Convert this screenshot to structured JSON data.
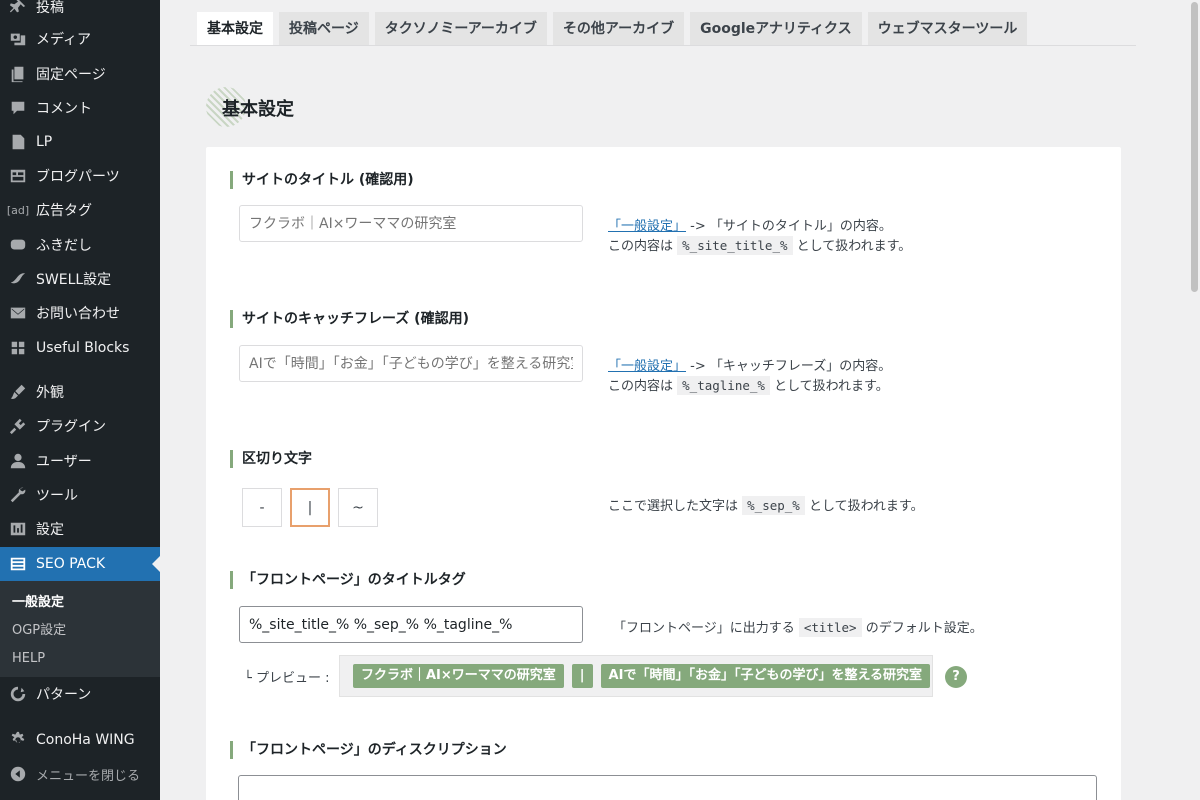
{
  "sidebar": {
    "items": [
      {
        "label": "投稿",
        "icon": "pin-icon"
      },
      {
        "label": "メディア",
        "icon": "media-icon"
      },
      {
        "label": "固定ページ",
        "icon": "page-icon"
      },
      {
        "label": "コメント",
        "icon": "comment-icon"
      },
      {
        "label": "LP",
        "icon": "document-icon"
      },
      {
        "label": "ブログパーツ",
        "icon": "blocks-icon"
      },
      {
        "label": "広告タグ",
        "icon": "ad-icon",
        "icon_text": "[ad]"
      },
      {
        "label": "ふきだし",
        "icon": "speech-bubble-icon"
      },
      {
        "label": "SWELL設定",
        "icon": "swell-icon"
      },
      {
        "label": "お問い合わせ",
        "icon": "mail-icon"
      },
      {
        "label": "Useful Blocks",
        "icon": "grid-icon"
      },
      {
        "label": "外観",
        "icon": "brush-icon"
      },
      {
        "label": "プラグイン",
        "icon": "plugin-icon"
      },
      {
        "label": "ユーザー",
        "icon": "user-icon"
      },
      {
        "label": "ツール",
        "icon": "wrench-icon"
      },
      {
        "label": "設定",
        "icon": "settings-icon"
      },
      {
        "label": "SEO PACK",
        "icon": "list-icon",
        "active": true
      }
    ],
    "submenu": [
      {
        "label": "一般設定",
        "current": true
      },
      {
        "label": "OGP設定"
      },
      {
        "label": "HELP"
      }
    ],
    "after": [
      {
        "label": "パターン",
        "icon": "pattern-icon"
      },
      {
        "label": "ConoHa WING",
        "icon": "gear-icon"
      },
      {
        "label": "メニューを閉じる",
        "icon": "collapse-icon"
      }
    ]
  },
  "tabs": [
    {
      "label": "基本設定",
      "active": true
    },
    {
      "label": "投稿ページ"
    },
    {
      "label": "タクソノミーアーカイブ"
    },
    {
      "label": "その他アーカイブ"
    },
    {
      "label": "Googleアナリティクス"
    },
    {
      "label": "ウェブマスターツール"
    }
  ],
  "section_title": "基本設定",
  "fields": {
    "site_title": {
      "label": "サイトのタイトル (確認用)",
      "placeholder": "フクラボ｜AI×ワーママの研究室",
      "desc_link": "「一般設定」",
      "desc_line1": " -> 「サイトのタイトル」の内容。",
      "desc_line2_pre": "この内容は ",
      "desc_code": "%_site_title_%",
      "desc_line2_post": " として扱われます。"
    },
    "tagline": {
      "label": "サイトのキャッチフレーズ (確認用)",
      "placeholder": "AIで「時間」「お金」「子どもの学び」を整える研究室",
      "desc_link": "「一般設定」",
      "desc_line1": " -> 「キャッチフレーズ」の内容。",
      "desc_line2_pre": "この内容は ",
      "desc_code": "%_tagline_%",
      "desc_line2_post": " として扱われます。"
    },
    "separator": {
      "label": "区切り文字",
      "options": [
        "-",
        "|",
        "~"
      ],
      "selected": "|",
      "desc_pre": "ここで選択した文字は ",
      "desc_code": "%_sep_%",
      "desc_post": " として扱われます。"
    },
    "front_title": {
      "label": "「フロントページ」のタイトルタグ",
      "value": "%_site_title_% %_sep_% %_tagline_%",
      "desc_pre": "「フロントページ」に出力する ",
      "desc_code": "<title>",
      "desc_post": " のデフォルト設定。",
      "preview_label": "└ プレビュー :",
      "preview_chips": [
        "フクラボ｜AI×ワーママの研究室",
        "|",
        "AIで「時間」「お金」「子どもの学び」を整える研究室"
      ],
      "help": "?"
    },
    "front_description": {
      "label": "「フロントページ」のディスクリプション"
    }
  },
  "colors": {
    "sidebar_bg": "#1d2327",
    "active_menu": "#2271b1",
    "accent_green": "#85a97c",
    "selected_border": "#e8a06c",
    "link": "#2271b1"
  }
}
